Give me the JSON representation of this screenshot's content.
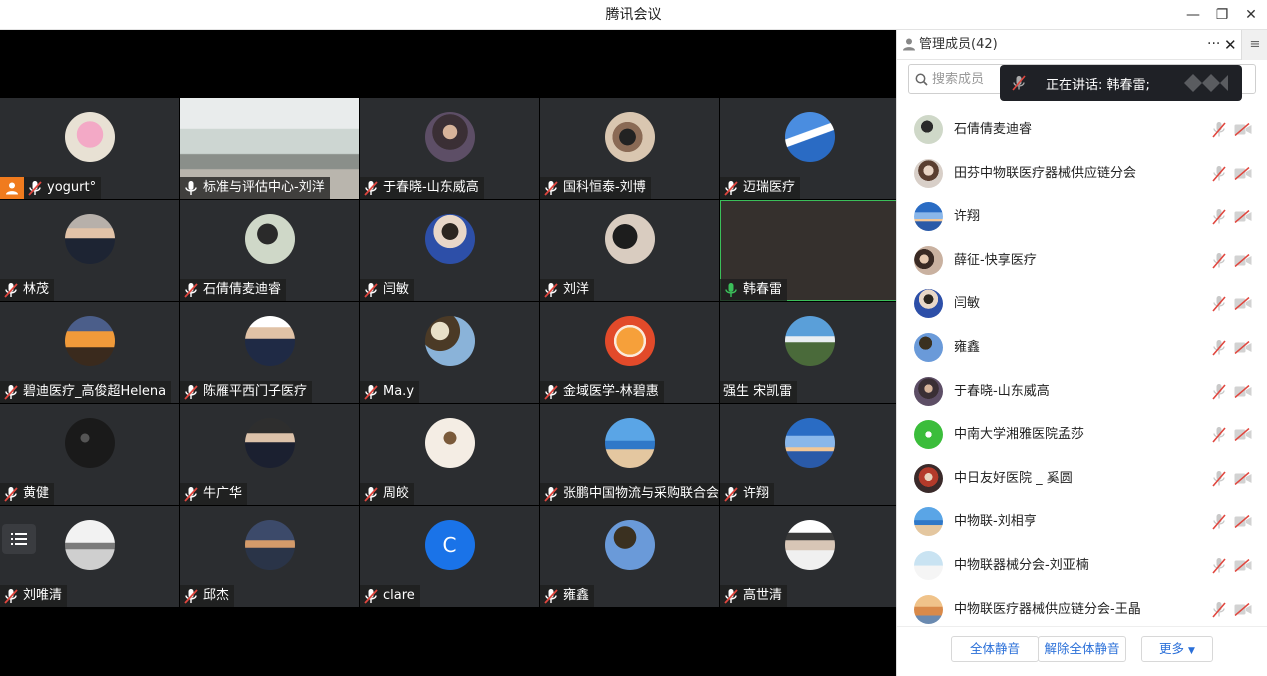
{
  "window": {
    "title": "腾讯会议",
    "minimize": "—",
    "restore": "❐",
    "close": "✕"
  },
  "grid": [
    {
      "name": "yogurt°",
      "mic": "muted",
      "host": true,
      "avatar": "pink-cartoon"
    },
    {
      "name": "标准与评估中心-刘洋",
      "mic": "on-white",
      "video": "meeting-room"
    },
    {
      "name": "于春晓-山东威高",
      "mic": "muted",
      "avatar": "woman-portrait"
    },
    {
      "name": "国科恒泰-刘博",
      "mic": "muted",
      "avatar": "camera-photo"
    },
    {
      "name": "迈瑞医疗",
      "mic": "muted",
      "avatar": "jet-photo"
    },
    {
      "name": "林茂",
      "mic": "muted",
      "avatar": "man-suit"
    },
    {
      "name": "石倩倩麦迪睿",
      "mic": "muted",
      "avatar": "woman-outdoor"
    },
    {
      "name": "闫敏",
      "mic": "muted",
      "avatar": "woman-blue"
    },
    {
      "name": "刘洋",
      "mic": "muted",
      "avatar": "man-glasses"
    },
    {
      "name": "韩春雷",
      "mic": "speaking",
      "speaking": true
    },
    {
      "name": "碧迪医疗_高俊超Helena",
      "mic": "muted",
      "avatar": "sunset-tree"
    },
    {
      "name": "陈雁平西门子医疗",
      "mic": "muted",
      "avatar": "man-suit-2"
    },
    {
      "name": "Ma.y",
      "mic": "muted",
      "avatar": "flowers"
    },
    {
      "name": "金域医学-林碧惠",
      "mic": "muted",
      "avatar": "tiger"
    },
    {
      "name": "强生 宋凯雷",
      "mic": "none",
      "avatar": "mountain"
    },
    {
      "name": "黄健",
      "mic": "muted",
      "avatar": "dark-photo"
    },
    {
      "name": "牛广华",
      "mic": "muted",
      "avatar": "man-suit-3"
    },
    {
      "name": "周皎",
      "mic": "muted",
      "avatar": "cartoon-girl"
    },
    {
      "name": "张鹏中国物流与采购联合会",
      "mic": "muted",
      "avatar": "beach"
    },
    {
      "name": "许翔",
      "mic": "muted",
      "avatar": "sky-sunset"
    },
    {
      "name": "刘唯清",
      "mic": "muted",
      "avatar": "bw-landscape"
    },
    {
      "name": "邱杰",
      "mic": "muted",
      "avatar": "sunset-sea"
    },
    {
      "name": "clare",
      "mic": "muted",
      "avatar": "letter",
      "letter": "C"
    },
    {
      "name": "雍鑫",
      "mic": "muted",
      "avatar": "tree-sky"
    },
    {
      "name": "高世清",
      "mic": "muted",
      "avatar": "man-presenting"
    }
  ],
  "panel": {
    "title": "管理成员(42)",
    "more": "···",
    "close": "✕",
    "menu": "≡",
    "search_placeholder": "搜索成员",
    "toast": "正在讲话: 韩春雷;",
    "members": [
      {
        "name": "石倩倩麦迪睿",
        "avatar": "woman-outdoor"
      },
      {
        "name": "田芬中物联医疗器械供应链分会",
        "avatar": "woman-2"
      },
      {
        "name": "许翔",
        "avatar": "sky-sunset"
      },
      {
        "name": "薛征-快享医疗",
        "avatar": "couple"
      },
      {
        "name": "闫敏",
        "avatar": "woman-blue"
      },
      {
        "name": "雍鑫",
        "avatar": "tree-sky"
      },
      {
        "name": "于春晓-山东威高",
        "avatar": "woman-portrait"
      },
      {
        "name": "中南大学湘雅医院孟莎",
        "avatar": "green-cartoon"
      },
      {
        "name": "中日友好医院 _ 奚圆",
        "avatar": "red-photo"
      },
      {
        "name": "中物联-刘相亨",
        "avatar": "beach"
      },
      {
        "name": "中物联器械分会-刘亚楠",
        "avatar": "snow"
      },
      {
        "name": "中物联医疗器械供应链分会-王晶",
        "avatar": "city"
      }
    ],
    "footer": {
      "mute_all": "全体静音",
      "unmute_all": "解除全体静音",
      "more": "更多"
    }
  },
  "colors": {
    "tile_bg": "#2b2d30",
    "speaking_green": "#3bbf5a",
    "muted_red": "#e0473f",
    "accent_blue": "#2a6fd8",
    "host_orange": "#f07b1e"
  }
}
